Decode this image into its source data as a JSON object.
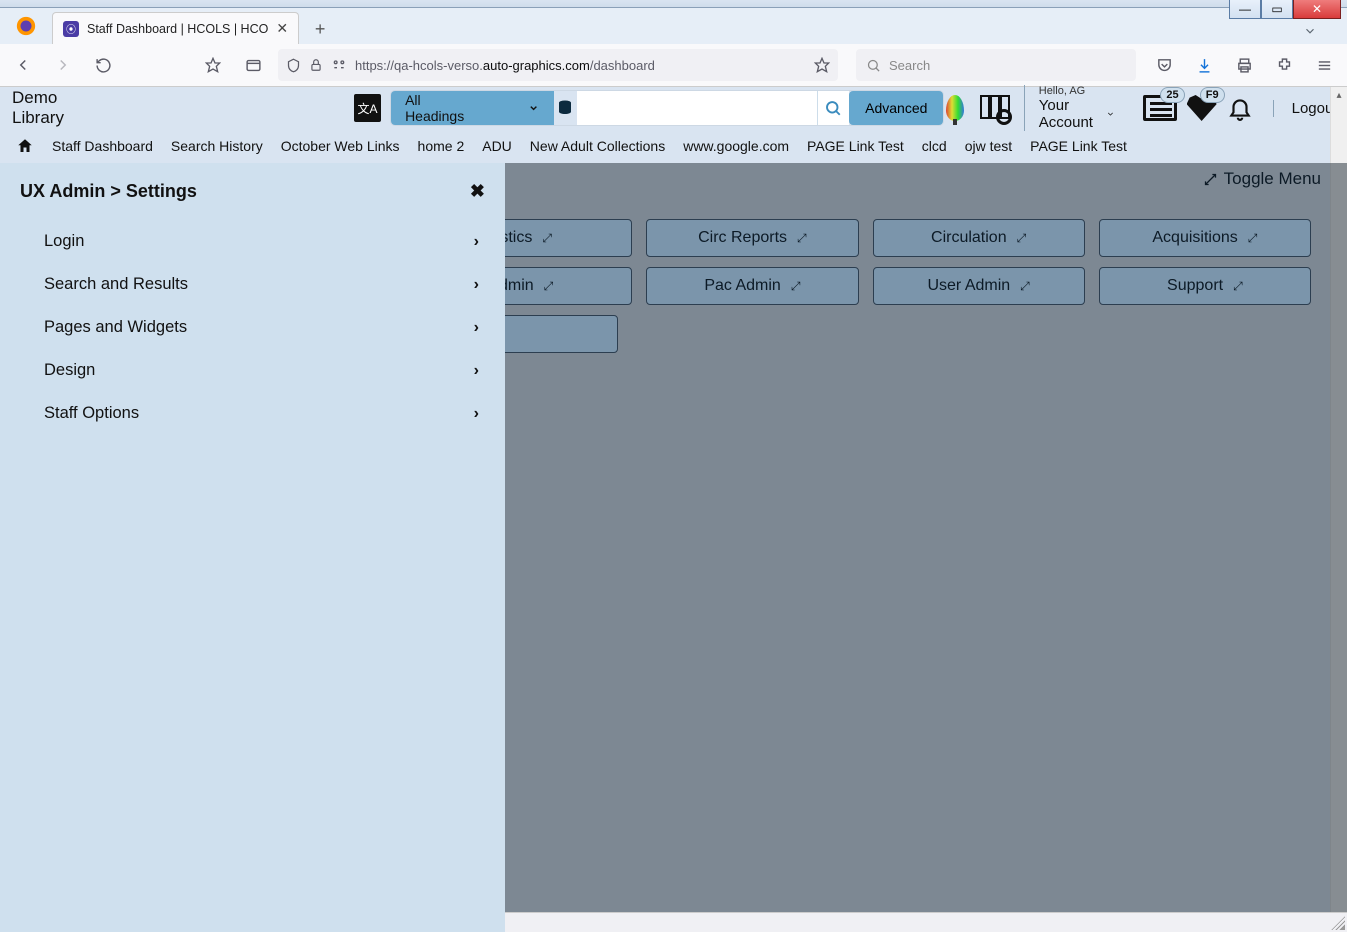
{
  "os": {
    "minimize": "–",
    "maximize": "❐",
    "close": "✕"
  },
  "browser": {
    "tab_title": "Staff Dashboard | HCOLS | HCO",
    "new_tab": "+",
    "url_host_pre": "https://qa-hcols-verso.",
    "url_host_bold": "auto-graphics.com",
    "url_path": "/dashboard",
    "search_placeholder": "Search"
  },
  "app": {
    "library_name": "Demo Library",
    "headings_label": "All Headings",
    "advanced_label": "Advanced",
    "hello": "Hello, AG",
    "account_label": "Your Account",
    "logout_label": "Logout",
    "list_badge": "25",
    "heart_badge": "F9"
  },
  "nav": {
    "items": [
      "Staff Dashboard",
      "Search History",
      "October Web Links",
      "home 2",
      "ADU",
      "New Adult Collections",
      "www.google.com",
      "PAGE Link Test",
      "clcd",
      "ojw test",
      "PAGE Link Test"
    ]
  },
  "dash": {
    "toggle_label": "Toggle Menu",
    "row1": [
      "stics",
      "Circ Reports",
      "Circulation",
      "Acquisitions"
    ],
    "row2": [
      "dmin",
      "Pac Admin",
      "User Admin",
      "Support"
    ]
  },
  "panel": {
    "breadcrumb": "UX Admin  >  Settings",
    "items": [
      "Login",
      "Search and Results",
      "Pages and Widgets",
      "Design",
      "Staff Options"
    ]
  }
}
